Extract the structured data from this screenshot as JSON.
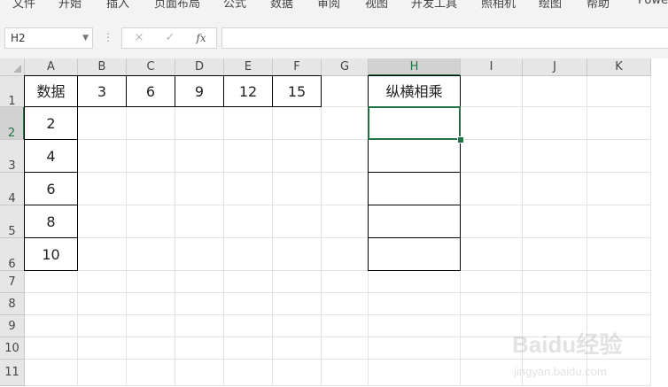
{
  "ribbon": {
    "tabs": [
      "文件",
      "开始",
      "插入",
      "页面布局",
      "公式",
      "数据",
      "审阅",
      "视图",
      "开发工具",
      "照相机",
      "绘图",
      "帮助",
      "Powe"
    ]
  },
  "formula_bar": {
    "name_box": "H2",
    "cancel_icon": "×",
    "enter_icon": "✓",
    "fx_label": "fx",
    "formula": ""
  },
  "sheet": {
    "columns": [
      "A",
      "B",
      "C",
      "D",
      "E",
      "F",
      "G",
      "H",
      "I",
      "J",
      "K"
    ],
    "rows": [
      "1",
      "2",
      "3",
      "4",
      "5",
      "6",
      "7",
      "8",
      "9",
      "10",
      "11"
    ],
    "selected_cell": "H2",
    "cells": {
      "A1": "数据",
      "B1": "3",
      "C1": "6",
      "D1": "9",
      "E1": "12",
      "F1": "15",
      "H1": "纵横相乘",
      "A2": "2",
      "A3": "4",
      "A4": "6",
      "A5": "8",
      "A6": "10"
    },
    "bordered_cells": [
      "A1",
      "B1",
      "C1",
      "D1",
      "E1",
      "F1",
      "A2",
      "A3",
      "A4",
      "A5",
      "A6",
      "H1",
      "H2",
      "H3",
      "H4",
      "H5",
      "H6"
    ]
  },
  "watermark": {
    "brand": "Baidu经验",
    "url": "jingyan.baidu.com"
  }
}
